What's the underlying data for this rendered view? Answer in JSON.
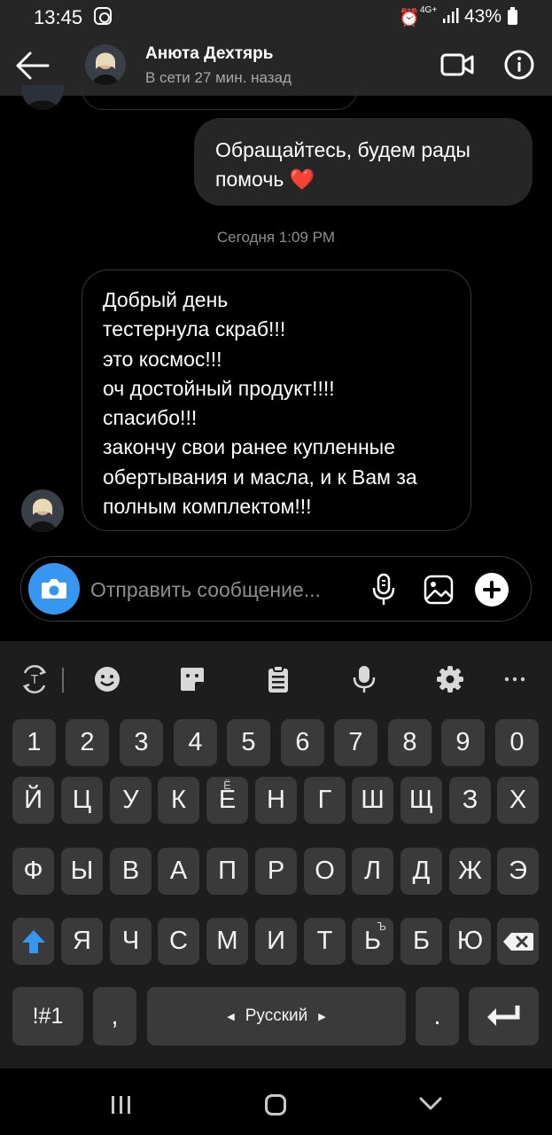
{
  "status_bar": {
    "time": "13:45",
    "network": "4G+",
    "battery": "43%"
  },
  "header": {
    "contact_name": "Анюта Дехтярь",
    "contact_status": "В сети 27 мин. назад"
  },
  "messages": {
    "outgoing_text": "Обращайтесь, будем рады помочь",
    "outgoing_emoji": "❤️",
    "date_separator": "Сегодня 1:09 PM",
    "incoming_text": "Добрый день\nтестернула скраб!!!\nэто космос!!!\nоч достойный продукт!!!!\nспасибо!!!\nзакончу свои ранее купленные обертывания и масла, и к Вам за полным комплектом!!!"
  },
  "composer": {
    "placeholder": "Отправить сообщение..."
  },
  "keyboard": {
    "numbers": [
      "1",
      "2",
      "3",
      "4",
      "5",
      "6",
      "7",
      "8",
      "9",
      "0"
    ],
    "row1": [
      "Й",
      "Ц",
      "У",
      "К",
      "Е",
      "Н",
      "Г",
      "Ш",
      "Щ",
      "З",
      "Х"
    ],
    "row1_alt_e": "Ё",
    "row2": [
      "Ф",
      "Ы",
      "В",
      "А",
      "П",
      "Р",
      "О",
      "Л",
      "Д",
      "Ж",
      "Э"
    ],
    "row3": [
      "Я",
      "Ч",
      "С",
      "М",
      "И",
      "Т",
      "Ь",
      "Б",
      "Ю"
    ],
    "row3_alt_soft": "Ъ",
    "symbols_key": "!#1",
    "comma_key": ",",
    "language_key": "Русский",
    "period_key": "."
  },
  "colors": {
    "accent_blue": "#3797f0",
    "heart_red": "#e0162b",
    "header_bg": "#262626",
    "keyboard_bg": "#1d1d1d",
    "key_bg": "#3a3a3a"
  }
}
